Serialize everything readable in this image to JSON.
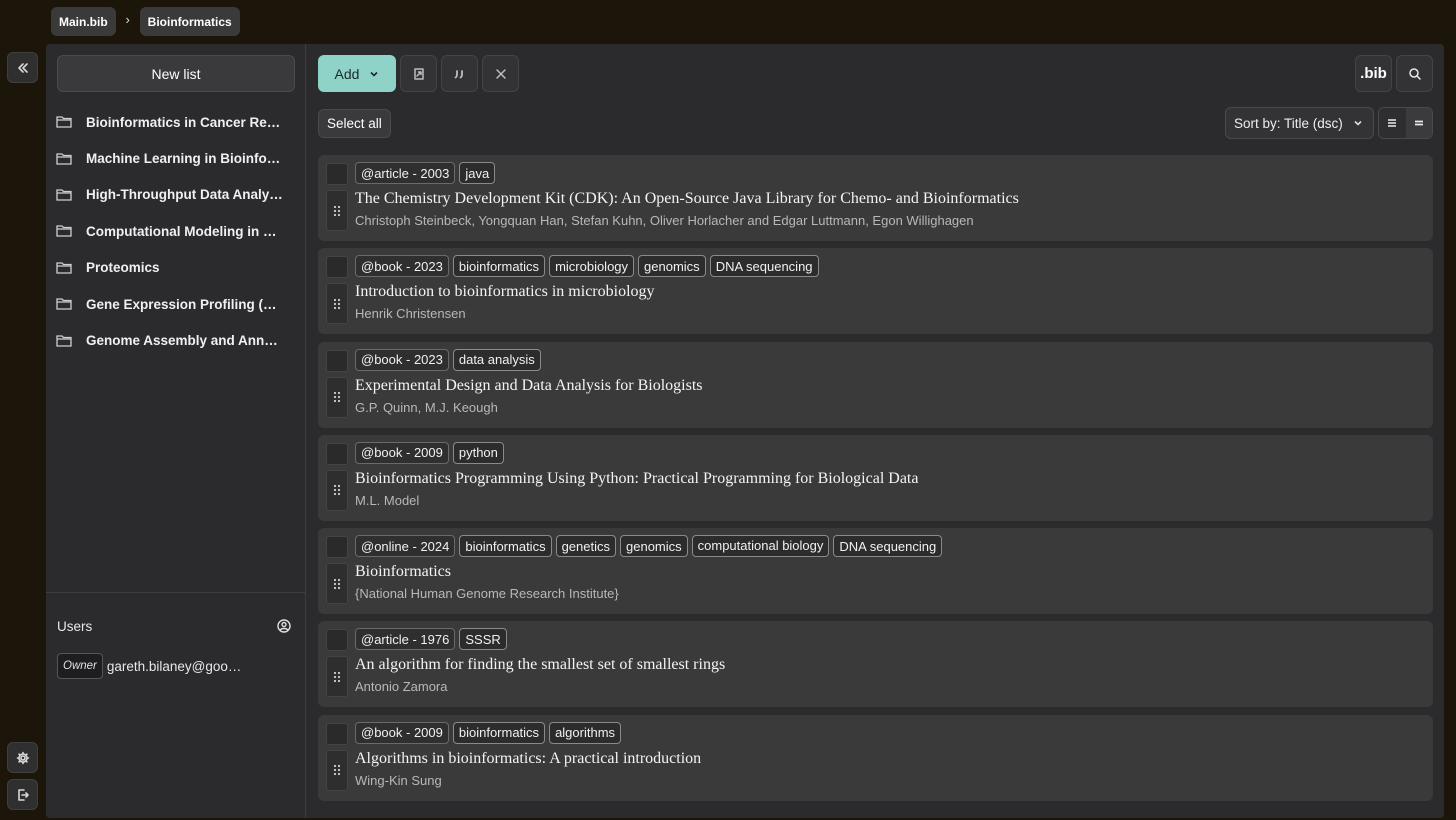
{
  "breadcrumb": {
    "root": "Main.bib",
    "current": "Bioinformatics"
  },
  "sidebar": {
    "new_list_label": "New list",
    "lists": [
      {
        "label": "Bioinformatics in Cancer Research"
      },
      {
        "label": "Machine Learning in Bioinformatics"
      },
      {
        "label": "High-Throughput Data Analysis"
      },
      {
        "label": "Computational Modeling in Systems Biology"
      },
      {
        "label": "Proteomics"
      },
      {
        "label": "Gene Expression Profiling (RNA-Seq)"
      },
      {
        "label": "Genome Assembly and Annotation"
      }
    ],
    "users_title": "Users",
    "users": [
      {
        "role": "Owner",
        "email": "gareth.bilaney@google.com"
      }
    ]
  },
  "toolbar": {
    "add_label": "Add",
    "bib_label": ".bib"
  },
  "controls": {
    "select_all_label": "Select all",
    "sort_label": "Sort by: Title (dsc)"
  },
  "entries": [
    {
      "type": "@article - 2003",
      "tags": [
        "java"
      ],
      "title": "The Chemistry Development Kit (CDK):  An Open-Source Java Library for Chemo- and Bioinformatics",
      "authors": "Christoph Steinbeck, Yongquan Han, Stefan Kuhn, Oliver Horlacher and Edgar Luttmann, Egon Willighagen"
    },
    {
      "type": "@book - 2023",
      "tags": [
        "bioinformatics",
        "microbiology",
        "genomics",
        "DNA sequencing"
      ],
      "title": "Introduction to bioinformatics in microbiology",
      "authors": "Henrik Christensen"
    },
    {
      "type": "@book - 2023",
      "tags": [
        "data analysis"
      ],
      "title": "Experimental Design and Data Analysis for Biologists",
      "authors": "G.P. Quinn, M.J. Keough"
    },
    {
      "type": "@book - 2009",
      "tags": [
        "python"
      ],
      "title": "Bioinformatics Programming Using Python: Practical Programming for Biological Data",
      "authors": "M.L. Model"
    },
    {
      "type": "@online - 2024",
      "tags": [
        "bioinformatics",
        "genetics",
        "genomics",
        "computational biology",
        "DNA sequencing"
      ],
      "title": "Bioinformatics",
      "authors": "{National Human Genome Research Institute}"
    },
    {
      "type": "@article - 1976",
      "tags": [
        "SSSR"
      ],
      "title": "An algorithm for finding the smallest set of smallest rings",
      "authors": "Antonio Zamora"
    },
    {
      "type": "@book - 2009",
      "tags": [
        "bioinformatics",
        "algorithms"
      ],
      "title": "Algorithms in bioinformatics: A practical introduction",
      "authors": "Wing-Kin Sung"
    }
  ]
}
